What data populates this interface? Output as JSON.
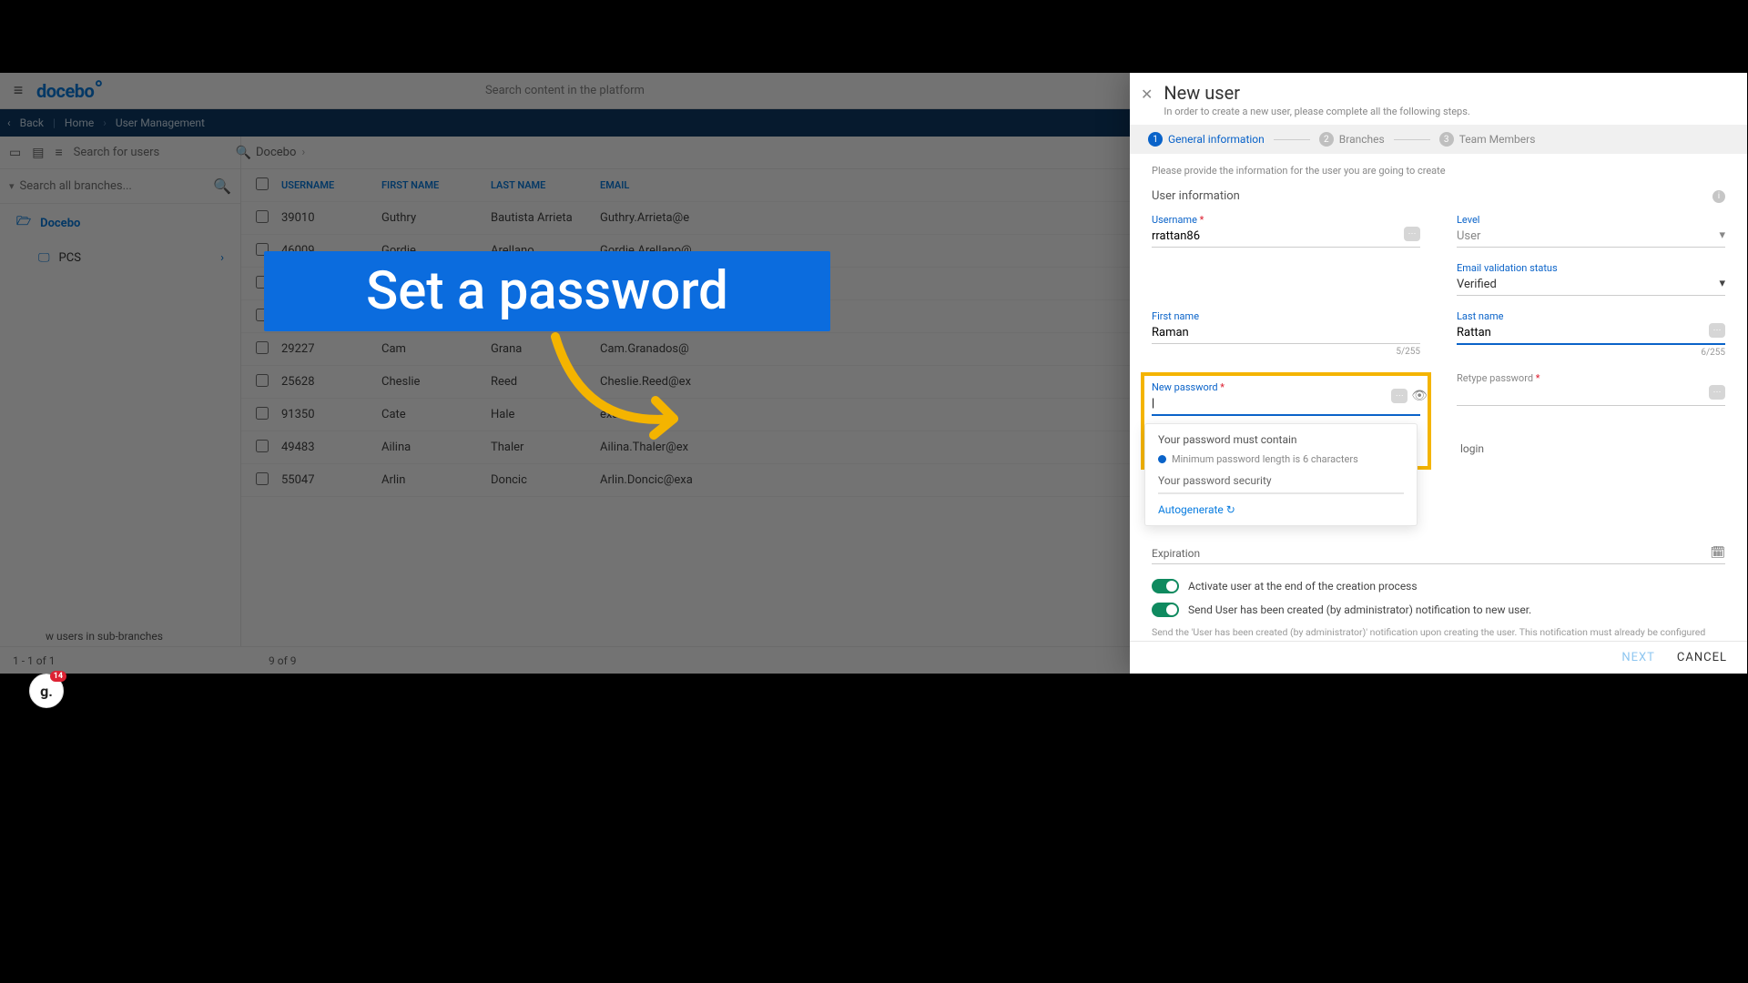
{
  "header": {
    "logo": "docebo",
    "search_placeholder": "Search content in the platform"
  },
  "breadcrumb": {
    "back": "Back",
    "home": "Home",
    "page": "User Management"
  },
  "side": {
    "search_users_placeholder": "Search for users",
    "search_branches_placeholder": "Search all branches...",
    "branches": [
      {
        "label": "Docebo",
        "selected": true
      },
      {
        "label": "PCS",
        "selected": false
      }
    ],
    "sub_branches_label": "w users in sub-branches",
    "page_info": "1 - 1 of 1"
  },
  "breadcrumb2": "Docebo",
  "table": {
    "cols": [
      "USERNAME",
      "FIRST NAME",
      "LAST NAME",
      "EMAIL"
    ],
    "rows": [
      {
        "u": "39010",
        "f": "Guthry",
        "l": "Bautista Arrieta",
        "e": "Guthry.Arrieta@e"
      },
      {
        "u": "46009",
        "f": "Gordie",
        "l": "Arellano",
        "e": "Gordie.Arellano@"
      },
      {
        "u": "",
        "f": "",
        "l": "",
        "e": ""
      },
      {
        "u": "",
        "f": "",
        "l": "",
        "e": ""
      },
      {
        "u": "29227",
        "f": "Cam",
        "l": "Grana",
        "e": "Cam.Granados@"
      },
      {
        "u": "25628",
        "f": "Cheslie",
        "l": "Reed",
        "e": "Cheslie.Reed@ex"
      },
      {
        "u": "91350",
        "f": "Cate",
        "l": "Hale",
        "e": "exam"
      },
      {
        "u": "49483",
        "f": "Ailina",
        "l": "Thaler",
        "e": "Ailina.Thaler@ex"
      },
      {
        "u": "55047",
        "f": "Arlin",
        "l": "Doncic",
        "e": "Arlin.Doncic@exa"
      }
    ],
    "count": "9 of 9"
  },
  "panel": {
    "title": "New user",
    "subtitle": "In order to create a new user, please complete all the following steps.",
    "steps": [
      "General information",
      "Branches",
      "Team Members"
    ],
    "hint": "Please provide the information for the user you are going to create",
    "section": "User information",
    "username_label": "Username",
    "username_value": "rrattan86",
    "level_label": "Level",
    "level_value": "User",
    "email_status_label": "Email validation status",
    "email_status_value": "Verified",
    "first_name_label": "First name",
    "first_name_value": "Raman",
    "first_name_counter": "5/255",
    "last_name_label": "Last name",
    "last_name_value": "Rattan",
    "last_name_counter": "6/255",
    "new_pw_label": "New password",
    "retype_pw_label": "Retype password",
    "pw_must": "Your password must contain",
    "pw_rule": "Minimum password length is 6 characters",
    "pw_security": "Your password security",
    "autogenerate": "Autogenerate",
    "login_suffix": "login",
    "expiration_label": "Expiration",
    "toggle1": "Activate user at the end of the creation process",
    "toggle2": "Send User has been created (by administrator) notification to new user.",
    "note": "Send the 'User has been created (by administrator)' notification upon creating the user. This notification must already be configured",
    "next": "NEXT",
    "cancel": "CANCEL"
  },
  "callout": "Set a password",
  "badge": {
    "letter": "g.",
    "count": "14"
  }
}
